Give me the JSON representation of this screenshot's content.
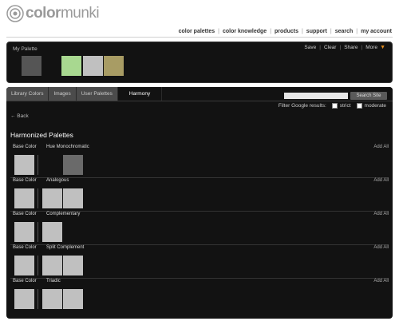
{
  "brand": {
    "name_bold": "color",
    "name_light": "munki"
  },
  "topnav": [
    "color palettes",
    "color knowledge",
    "products",
    "support",
    "search",
    "my account"
  ],
  "my_palette": {
    "title": "My Palette",
    "actions": [
      "Save",
      "Clear",
      "Share",
      "More"
    ],
    "swatches": [
      "#555555",
      "#121212",
      "#a8d890",
      "#c0c0c0",
      "#a89c64"
    ]
  },
  "tabs": [
    "Library Colors",
    "Images",
    "User Palettes",
    "Harmony"
  ],
  "active_tab": "Harmony",
  "search": {
    "value": "",
    "button": "Search Site"
  },
  "filter": {
    "label": "Filter Google results:",
    "options": [
      "strict",
      "moderate"
    ]
  },
  "back_label": "← Back",
  "section_title": "Harmonized Palettes",
  "harmonies": [
    {
      "base_label": "Base Color",
      "name": "Hue Monochromatic",
      "add_all": "Add All",
      "base": "#c0c0c0",
      "colors": [
        "#121212",
        "#6a6a6a"
      ]
    },
    {
      "base_label": "Base Color",
      "name": "Analogous",
      "add_all": "Add All",
      "base": "#c0c0c0",
      "colors": [
        "#c0c0c0",
        "#c0c0c0"
      ]
    },
    {
      "base_label": "Base Color",
      "name": "Complementary",
      "add_all": "Add All",
      "base": "#c0c0c0",
      "colors": [
        "#c0c0c0"
      ]
    },
    {
      "base_label": "Base Color",
      "name": "Split Complement",
      "add_all": "Add All",
      "base": "#c0c0c0",
      "colors": [
        "#c0c0c0",
        "#c0c0c0"
      ]
    },
    {
      "base_label": "Base Color",
      "name": "Triadic",
      "add_all": "Add All",
      "base": "#c0c0c0",
      "colors": [
        "#c0c0c0",
        "#c0c0c0"
      ]
    }
  ],
  "colors": {
    "panel": "#121212",
    "accent": "#e08a1e"
  }
}
